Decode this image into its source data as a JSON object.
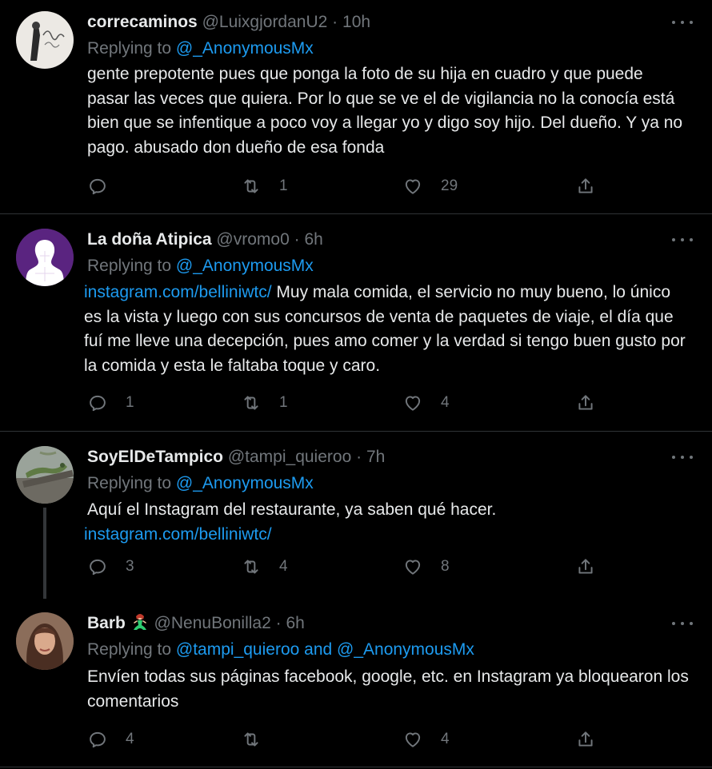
{
  "tweets": [
    {
      "name": "correcaminos",
      "handle": "@LuixgjordanU2",
      "sep": "·",
      "time": "10h",
      "replying_prefix": "Replying to ",
      "replying_to": "@_AnonymousMx",
      "body_link": "",
      "body_text": "gente prepotente pues que ponga la foto de su hija en cuadro y que puede pasar las veces que quiera. Por lo que se ve el de vigilancia no la conocía está bien que se infentique a poco voy a llegar yo y digo soy hijo. Del dueño. Y ya no pago. abusado don dueño de esa fonda",
      "replies": "",
      "retweets": "1",
      "likes": "29",
      "avatar_icon": "signature-photo-avatar"
    },
    {
      "name": "La doña Atipica",
      "handle": "@vromo0",
      "sep": "·",
      "time": "6h",
      "replying_prefix": "Replying to ",
      "replying_to": "@_AnonymousMx",
      "body_link": "instagram.com/belliniwtc/",
      "body_text": " Muy mala comida, el servicio no muy bueno, lo único es la vista y luego con sus concursos de venta de paquetes de viaje, el día que fuí me lleve una decepción, pues amo comer y la verdad si tengo buen gusto por la comida y esta le faltaba toque y caro.",
      "replies": "1",
      "retweets": "1",
      "likes": "4",
      "avatar_icon": "puzzle-silhouette-avatar"
    },
    {
      "name": "SoyElDeTampico",
      "handle": "@tampi_quieroo",
      "sep": "·",
      "time": "7h",
      "replying_prefix": "Replying to ",
      "replying_to": "@_AnonymousMx",
      "body_text": "Aquí el Instagram del restaurante, ya saben qué hacer.",
      "body_link2": "instagram.com/belliniwtc/",
      "replies": "3",
      "retweets": "4",
      "likes": "8",
      "avatar_icon": "iguana-photo-avatar"
    },
    {
      "name": "Barb",
      "name_emoji": "mermaid-emoji",
      "handle": "@NenuBonilla2",
      "sep": "·",
      "time": "6h",
      "replying_prefix": "Replying to ",
      "replying_to": "@tampi_quieroo and @_AnonymousMx",
      "body_text": "Envíen todas sus páginas facebook, google, etc. en Instagram ya bloquearon los comentarios",
      "replies": "4",
      "retweets": "",
      "likes": "4",
      "avatar_icon": "woman-photo-avatar"
    }
  ],
  "colors": {
    "background": "#000000",
    "text": "#e7e9ea",
    "secondary": "#71767b",
    "link": "#1d9bf0",
    "divider": "#2f3336"
  }
}
